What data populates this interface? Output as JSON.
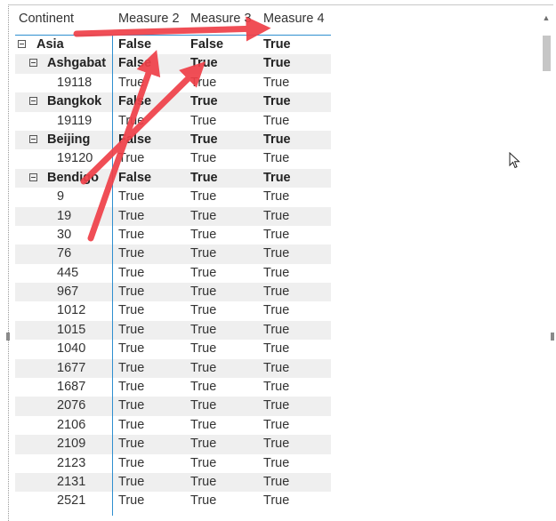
{
  "columns": [
    "Continent",
    "Measure 2",
    "Measure 3",
    "Measure 4"
  ],
  "rows": [
    {
      "label": "Asia",
      "m2": "False",
      "m3": "False",
      "m4": "True"
    },
    {
      "label": "Ashgabat",
      "m2": "False",
      "m3": "True",
      "m4": "True"
    },
    {
      "label": "19118",
      "m2": "True",
      "m3": "True",
      "m4": "True"
    },
    {
      "label": "Bangkok",
      "m2": "False",
      "m3": "True",
      "m4": "True"
    },
    {
      "label": "19119",
      "m2": "True",
      "m3": "True",
      "m4": "True"
    },
    {
      "label": "Beijing",
      "m2": "False",
      "m3": "True",
      "m4": "True"
    },
    {
      "label": "19120",
      "m2": "True",
      "m3": "True",
      "m4": "True"
    },
    {
      "label": "Bendigo",
      "m2": "False",
      "m3": "True",
      "m4": "True"
    },
    {
      "label": "9",
      "m2": "True",
      "m3": "True",
      "m4": "True"
    },
    {
      "label": "19",
      "m2": "True",
      "m3": "True",
      "m4": "True"
    },
    {
      "label": "30",
      "m2": "True",
      "m3": "True",
      "m4": "True"
    },
    {
      "label": "76",
      "m2": "True",
      "m3": "True",
      "m4": "True"
    },
    {
      "label": "445",
      "m2": "True",
      "m3": "True",
      "m4": "True"
    },
    {
      "label": "967",
      "m2": "True",
      "m3": "True",
      "m4": "True"
    },
    {
      "label": "1012",
      "m2": "True",
      "m3": "True",
      "m4": "True"
    },
    {
      "label": "1015",
      "m2": "True",
      "m3": "True",
      "m4": "True"
    },
    {
      "label": "1040",
      "m2": "True",
      "m3": "True",
      "m4": "True"
    },
    {
      "label": "1677",
      "m2": "True",
      "m3": "True",
      "m4": "True"
    },
    {
      "label": "1687",
      "m2": "True",
      "m3": "True",
      "m4": "True"
    },
    {
      "label": "2076",
      "m2": "True",
      "m3": "True",
      "m4": "True"
    },
    {
      "label": "2106",
      "m2": "True",
      "m3": "True",
      "m4": "True"
    },
    {
      "label": "2109",
      "m2": "True",
      "m3": "True",
      "m4": "True"
    },
    {
      "label": "2123",
      "m2": "True",
      "m3": "True",
      "m4": "True"
    },
    {
      "label": "2131",
      "m2": "True",
      "m3": "True",
      "m4": "True"
    },
    {
      "label": "2521",
      "m2": "True",
      "m3": "True",
      "m4": "True"
    }
  ],
  "colors": {
    "header_line": "#2f8fd0",
    "arrow": "#ef4048",
    "row_alt": "#efefef"
  },
  "icons": {
    "collapse": "minus-box-icon",
    "cursor": "mouse-pointer-icon",
    "scroll": "scroll-up-arrow-icon"
  }
}
